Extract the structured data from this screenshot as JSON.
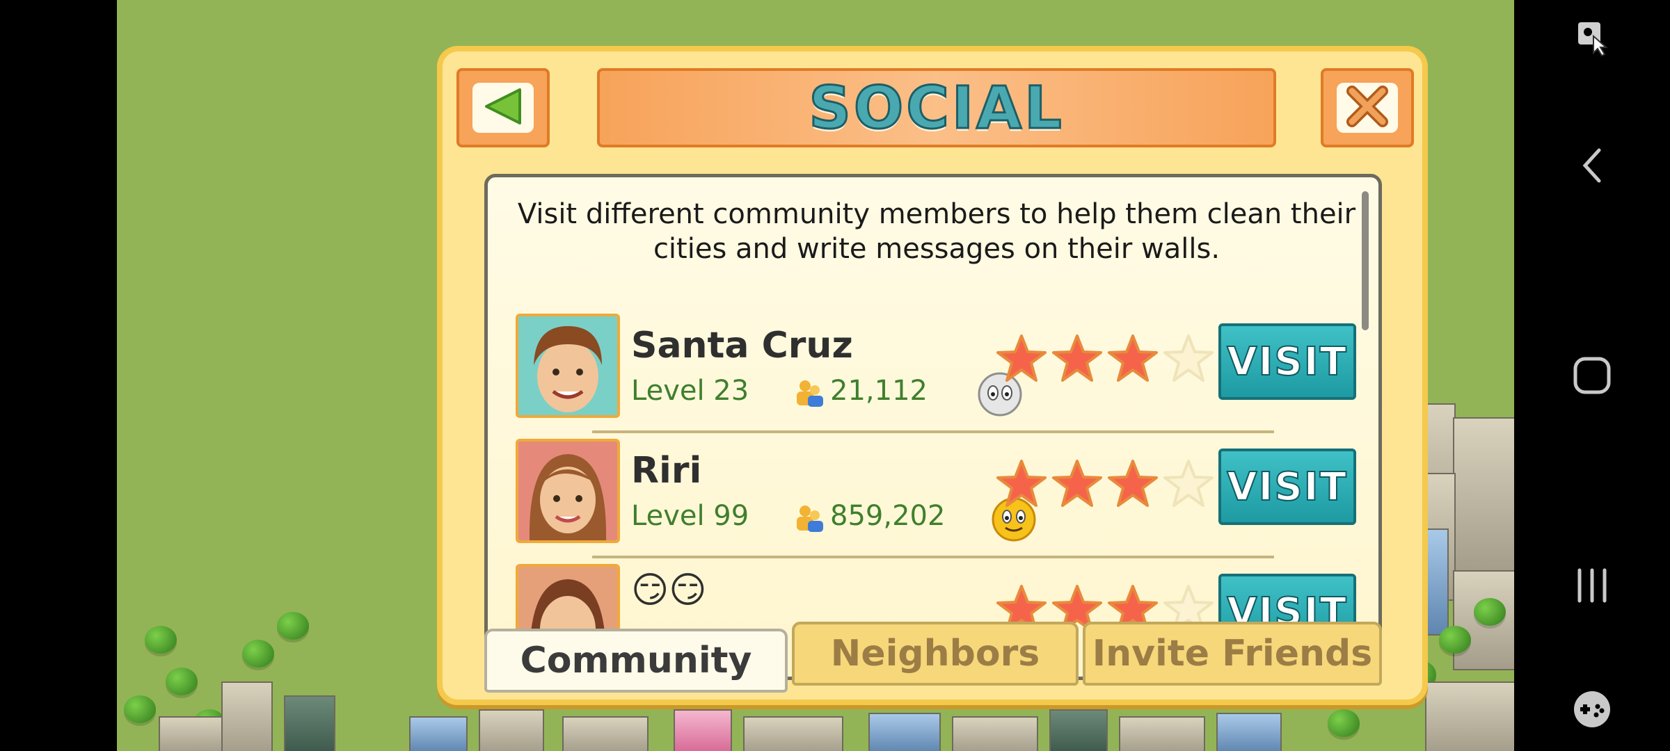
{
  "dialog": {
    "title": "SOCIAL",
    "back_button_icon": "back-arrow-icon",
    "close_button_icon": "close-x-icon",
    "intro_line1": "Visit different community members to help them clean their",
    "intro_line2": "cities and write messages on their walls."
  },
  "members": [
    {
      "name": "Santa Cruz",
      "level": "Level 23",
      "population": "21,112",
      "mood": "neutral-face-icon",
      "stars": 3,
      "max_stars": 4,
      "visit_label": "VISIT"
    },
    {
      "name": "Riri",
      "level": "Level 99",
      "population": "859,202",
      "mood": "smiley-face-icon",
      "stars": 3,
      "max_stars": 4,
      "visit_label": "VISIT"
    },
    {
      "name": "😏😏",
      "level": "",
      "population": "",
      "mood": "",
      "stars": 3,
      "max_stars": 4,
      "visit_label": "VISIT"
    }
  ],
  "tabs": [
    {
      "label": "Community",
      "active": true
    },
    {
      "label": "Neighbors",
      "active": false
    },
    {
      "label": "Invite Friends",
      "active": false
    }
  ],
  "colors": {
    "accent_teal": "#1e9aa2",
    "dialog_bg": "#fde594",
    "star_filled": "#f5644a",
    "level_green": "#3f7f2d"
  },
  "navbar": {
    "icons": [
      "screen-pin-icon",
      "back-icon",
      "home-icon",
      "recents-icon",
      "game-controller-icon"
    ]
  }
}
